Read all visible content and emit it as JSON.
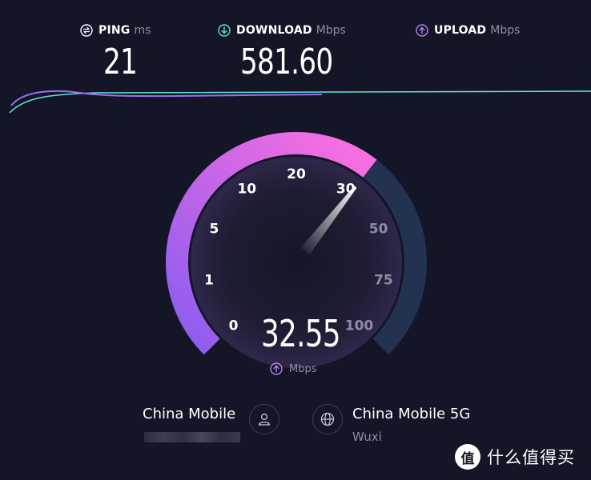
{
  "ping": {
    "label": "PING",
    "unit": "ms",
    "value": "21",
    "icon": "ping-icon"
  },
  "download": {
    "label": "DOWNLOAD",
    "unit": "Mbps",
    "value": "581.60",
    "icon": "download-arrow-icon",
    "color": "#5fe3d7"
  },
  "upload": {
    "label": "UPLOAD",
    "unit": "Mbps",
    "icon": "upload-arrow-icon",
    "color": "#b283f0"
  },
  "gauge": {
    "value": "32.55",
    "unit": "Mbps",
    "unit_icon": "upload-arrow-icon",
    "current": 32.55,
    "scale_labels": [
      "0",
      "1",
      "5",
      "10",
      "20",
      "30",
      "50",
      "75",
      "100"
    ],
    "colors": {
      "active_start": "#8a5cf0",
      "active_end": "#ff6fe0",
      "track": "#243252"
    }
  },
  "client": {
    "isp": "China Mobile",
    "icon": "user-icon"
  },
  "server": {
    "name": "China Mobile 5G",
    "location": "Wuxi",
    "icon": "globe-icon"
  },
  "watermark": {
    "badge": "值",
    "text": "什么值得买"
  }
}
